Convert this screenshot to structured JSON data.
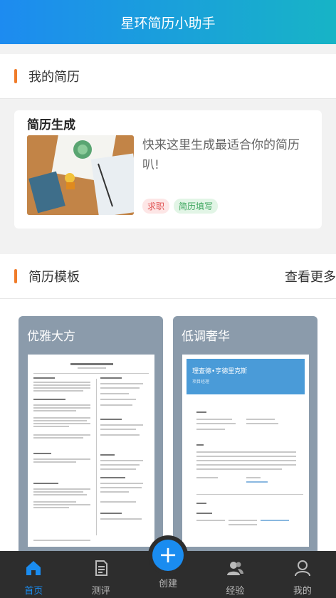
{
  "app": {
    "title": "星环简历小助手"
  },
  "my_resume": {
    "section_title": "我的简历",
    "card_title": "简历生成",
    "description": "快来这里生成最适合你的简历叭!",
    "tags": [
      "求职",
      "简历填写"
    ]
  },
  "templates": {
    "section_title": "简历模板",
    "more_label": "查看更多",
    "items": [
      {
        "name": "优雅大方"
      },
      {
        "name": "低调奢华"
      }
    ],
    "doc2": {
      "name": "理查德•亨德里克斯",
      "role": "项目经理"
    }
  },
  "tabbar": {
    "items": [
      {
        "label": "首页",
        "icon": "home-icon"
      },
      {
        "label": "测评",
        "icon": "document-icon"
      },
      {
        "label": "创建",
        "icon": "plus-icon"
      },
      {
        "label": "经验",
        "icon": "people-icon"
      },
      {
        "label": "我的",
        "icon": "user-icon"
      }
    ]
  },
  "colors": {
    "header_start": "#1d8bf0",
    "header_end": "#17b4c6",
    "accent": "#f07c2a",
    "active_tab": "#1a8cf0"
  }
}
